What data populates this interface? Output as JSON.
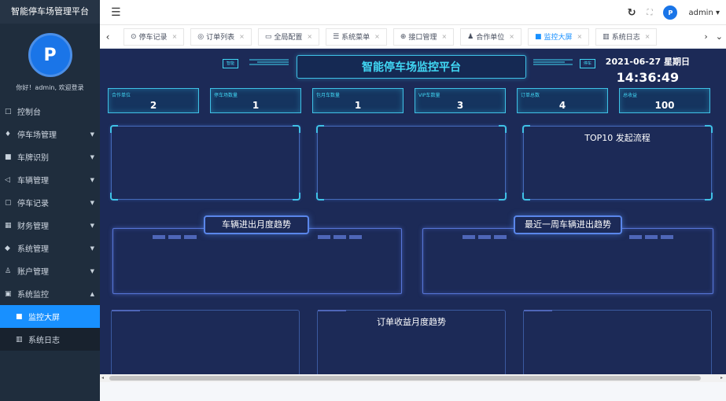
{
  "sidebar": {
    "app_title": "智能停车场管理平台",
    "avatar_text": "P",
    "welcome": "你好！admin, 欢迎登录",
    "items": [
      {
        "icon": "□",
        "label": "控制台",
        "caret": ""
      },
      {
        "icon": "♦",
        "label": "停车场管理",
        "caret": "▼"
      },
      {
        "icon": "■",
        "label": "车牌识别",
        "caret": "▼"
      },
      {
        "icon": "◁",
        "label": "车辆管理",
        "caret": "▼"
      },
      {
        "icon": "▢",
        "label": "停车记录",
        "caret": "▼"
      },
      {
        "icon": "▦",
        "label": "财务管理",
        "caret": "▼"
      },
      {
        "icon": "◆",
        "label": "系统管理",
        "caret": "▼"
      },
      {
        "icon": "♙",
        "label": "账户管理",
        "caret": "▼"
      },
      {
        "icon": "▣",
        "label": "系统监控",
        "caret": "▲"
      }
    ],
    "subitems": [
      {
        "icon": "■",
        "label": "监控大屏",
        "active": true
      },
      {
        "icon": "▥",
        "label": "系统日志",
        "active": false
      }
    ]
  },
  "header": {
    "hamburger_icon": "☰",
    "refresh_icon": "↻",
    "fullscreen_icon": "⛶",
    "username": "admin ▾",
    "avatar_text": "P"
  },
  "tabs": {
    "prev_icon": "‹",
    "next_icon": "›",
    "menu_icon": "⌄",
    "close_icon": "×",
    "items": [
      {
        "icon": "⊙",
        "label": "停车记录"
      },
      {
        "icon": "◎",
        "label": "订单列表"
      },
      {
        "icon": "▭",
        "label": "全局配置"
      },
      {
        "icon": "☰",
        "label": "系统菜单"
      },
      {
        "icon": "⊕",
        "label": "接口管理"
      },
      {
        "icon": "♟",
        "label": "合作单位"
      },
      {
        "icon": "■",
        "label": "监控大屏"
      },
      {
        "icon": "▥",
        "label": "系统日志"
      }
    ]
  },
  "dashboard": {
    "title": "智能停车场监控平台",
    "left_btn": "智能",
    "right_btn": "停车",
    "date": "2021-06-27 星期日",
    "time": "14:36:49",
    "stats": [
      {
        "label": "合作单位",
        "value": "2"
      },
      {
        "label": "停车场数量",
        "value": "1"
      },
      {
        "label": "包月车数量",
        "value": "1"
      },
      {
        "label": "VIP车数量",
        "value": "3"
      },
      {
        "label": "订单总数",
        "value": "4"
      },
      {
        "label": "总收益",
        "value": "100"
      }
    ],
    "top_panels": [
      {
        "heading": ""
      },
      {
        "heading": ""
      },
      {
        "heading": "TOP10 发起流程"
      }
    ],
    "mid_panels": [
      {
        "heading": "车辆进出月度趋势"
      },
      {
        "heading": "最近一周车辆进出趋势"
      }
    ],
    "bottom_panels": [
      {
        "heading": ""
      },
      {
        "heading": "订单收益月度趋势"
      },
      {
        "heading": ""
      }
    ]
  },
  "scrollbar": {
    "left_icon": "◂",
    "right_icon": "▸"
  }
}
